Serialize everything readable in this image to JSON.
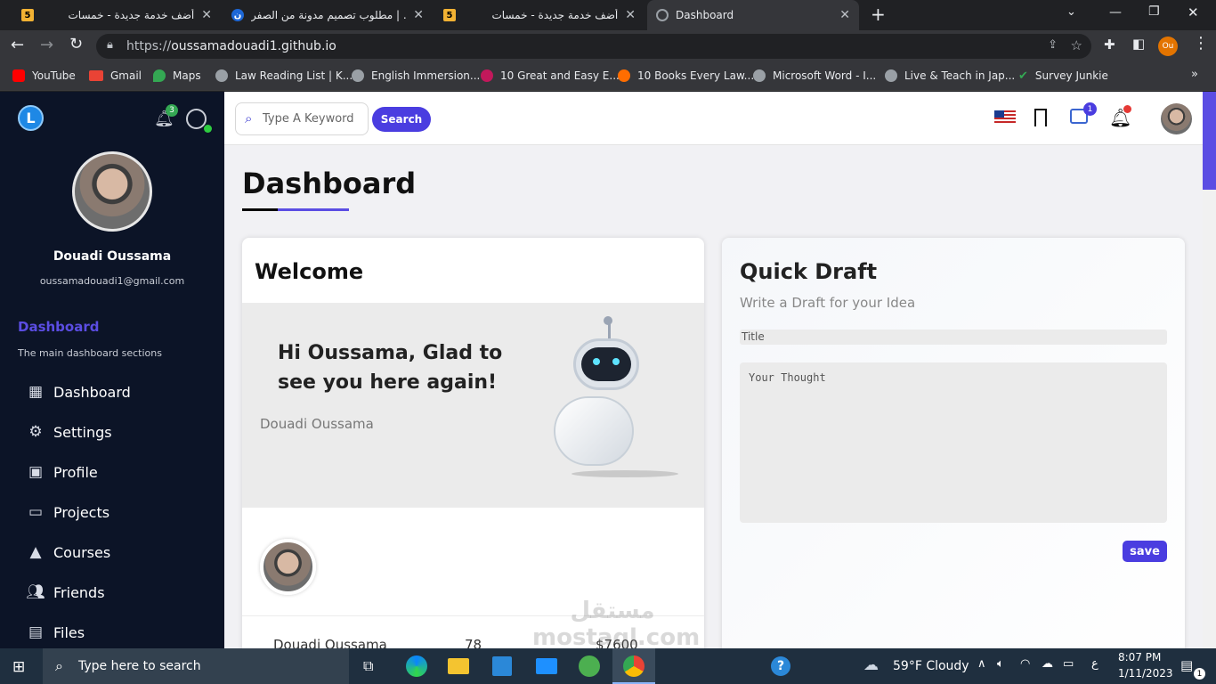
{
  "browser": {
    "tabs": [
      {
        "title": "أضف خدمة جديدة - خمسات",
        "favicon": "5"
      },
      {
        "title": "مطلوب تصميم مدونة من الصفر | ...",
        "favicon": "mostaql-icon"
      },
      {
        "title": "أضف خدمة جديدة - خمسات",
        "favicon": "5"
      },
      {
        "title": "Dashboard",
        "favicon": "globe-icon"
      }
    ],
    "url_prefix": "https://",
    "url_host": "oussamadouadi1.github.io",
    "profile_initials": "Ou",
    "bookmarks": [
      "YouTube",
      "Gmail",
      "Maps",
      "Law Reading List | K...",
      "English Immersion...",
      "10 Great and Easy E...",
      "10 Books Every Law...",
      "Microsoft Word - I...",
      "Live & Teach in Jap...",
      "Survey Junkie"
    ]
  },
  "sidebar": {
    "logo": "L",
    "notification_count": "3",
    "user_name": "Douadi Oussama",
    "user_email": "oussamadouadi1@gmail.com",
    "section_title": "Dashboard",
    "section_subtitle": "The main dashboard sections",
    "items": [
      {
        "label": "Dashboard",
        "icon": "grid-icon"
      },
      {
        "label": "Settings",
        "icon": "sliders-icon"
      },
      {
        "label": "Profile",
        "icon": "profile-icon"
      },
      {
        "label": "Projects",
        "icon": "presentation-icon"
      },
      {
        "label": "Courses",
        "icon": "graduation-cap-icon"
      },
      {
        "label": "Friends",
        "icon": "users-icon"
      },
      {
        "label": "Files",
        "icon": "file-icon"
      }
    ]
  },
  "topbar": {
    "search_placeholder": "Type A Keyword",
    "search_button": "Search",
    "messages_count": "1"
  },
  "main": {
    "page_title": "Dashboard",
    "welcome": {
      "title": "Welcome",
      "greeting": "Hi Oussama, Glad to see you here again!",
      "name": "Douadi Oussama",
      "stats_name": "Douadi Oussama",
      "stats_count": "78",
      "stats_money": "$7600"
    },
    "draft": {
      "title": "Quick Draft",
      "subtitle": "Write a Draft for your Idea",
      "title_placeholder": "Title",
      "thought_placeholder": "Your Thought",
      "save_label": "save"
    }
  },
  "taskbar": {
    "search_placeholder": "Type here to search",
    "weather": "59°F  Cloudy",
    "time": "8:07 PM",
    "date": "1/11/2023",
    "lang": "ع",
    "notification_count": "1"
  },
  "watermark": "مستقل mostaql.com",
  "colors": {
    "accent": "#5b4de3",
    "sidebar_bg": "#0c1427",
    "page_bg": "#f1f1f4"
  }
}
